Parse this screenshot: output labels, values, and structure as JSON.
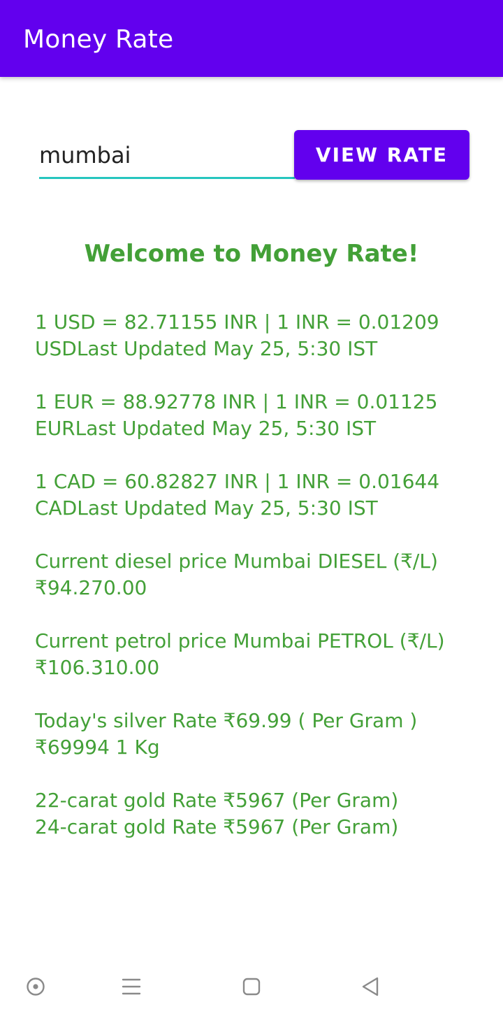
{
  "app_bar": {
    "title": "Money Rate"
  },
  "search": {
    "value": "mumbai"
  },
  "view_button": {
    "label": "VIEW RATE"
  },
  "welcome": {
    "text": "Welcome to Money Rate!"
  },
  "rates": [
    {
      "line1": "1 USD = 82.71155 INR | 1 INR = 0.01209",
      "line2": "USDLast Updated May 25, 5:30 IST"
    },
    {
      "line1": "1 EUR = 88.92778 INR | 1 INR = 0.01125",
      "line2": "EURLast Updated May 25, 5:30 IST"
    },
    {
      "line1": "1 CAD = 60.82827 INR | 1 INR = 0.01644",
      "line2": "CADLast Updated May 25, 5:30 IST"
    },
    {
      "line1": "Current diesel price Mumbai DIESEL (₹/L)",
      "line2": "₹94.270.00"
    },
    {
      "line1": "Current petrol price Mumbai PETROL (₹/L)",
      "line2": "₹106.310.00"
    },
    {
      "line1": "Today's silver Rate ₹69.99 ( Per Gram )",
      "line2": "₹69994 1 Kg"
    },
    {
      "line1": "22-carat gold Rate ₹5967 (Per Gram)",
      "line2": "24-carat gold Rate ₹5967 (Per Gram)"
    }
  ],
  "colors": {
    "primary": "#6200ee",
    "accent": "#26c6bf",
    "text_green": "#43a037",
    "nav_icon": "#8a8a8a"
  },
  "nav": {
    "icons": [
      "assistant-icon",
      "menu-icon",
      "home-square-icon",
      "back-triangle-icon"
    ]
  }
}
